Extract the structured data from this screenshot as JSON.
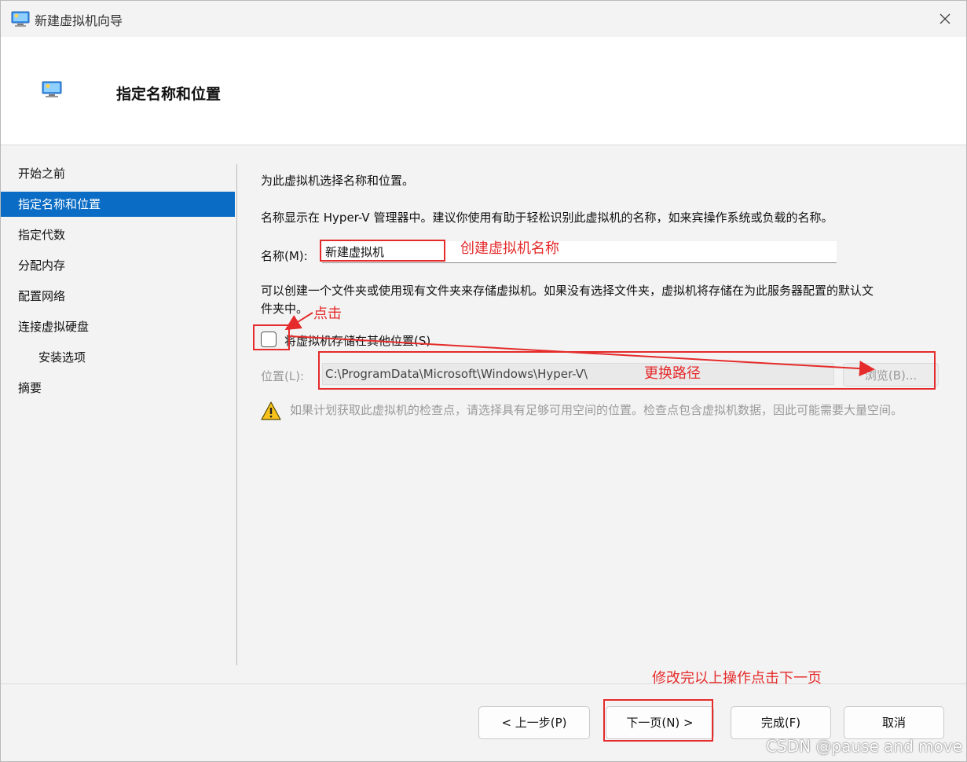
{
  "window": {
    "title": "新建虚拟机向导",
    "close_icon": "close-icon"
  },
  "header": {
    "title": "指定名称和位置"
  },
  "sidebar": {
    "items": [
      {
        "label": "开始之前"
      },
      {
        "label": "指定名称和位置",
        "active": true
      },
      {
        "label": "指定代数"
      },
      {
        "label": "分配内存"
      },
      {
        "label": "配置网络"
      },
      {
        "label": "连接虚拟硬盘"
      },
      {
        "label": "安装选项"
      },
      {
        "label": "摘要"
      }
    ]
  },
  "main": {
    "intro": "为此虚拟机选择名称和位置。",
    "description": "名称显示在 Hyper-V 管理器中。建议你使用有助于轻松识别此虚拟机的名称，如来宾操作系统或负载的名称。",
    "name_label": "名称(M):",
    "name_value": "新建虚拟机",
    "folder_text_line1": "可以创建一个文件夹或使用现有文件夹来存储虚拟机。如果没有选择文件夹，虚拟机将存储在为此服务器配置的默认文",
    "folder_text_line2": "件夹中。",
    "store_checkbox_label": "将虚拟机存储在其他位置(S)",
    "store_checkbox_checked": false,
    "location_label": "位置(L):",
    "location_value": "C:\\ProgramData\\Microsoft\\Windows\\Hyper-V\\",
    "browse_label": "浏览(B)...",
    "warning_text": "如果计划获取此虚拟机的检查点，请选择具有足够可用空间的位置。检查点包含虚拟机数据，因此可能需要大量空间。"
  },
  "footer": {
    "prev_label": "< 上一步(P)",
    "next_label": "下一页(N) >",
    "finish_label": "完成(F)",
    "cancel_label": "取消"
  },
  "annotations": {
    "name_note": "创建虚拟机名称",
    "click_note": "点击",
    "path_note": "更换路径",
    "next_note": "修改完以上操作点击下一页",
    "color": "#e52b2b"
  },
  "watermark": "CSDN @pause and move"
}
